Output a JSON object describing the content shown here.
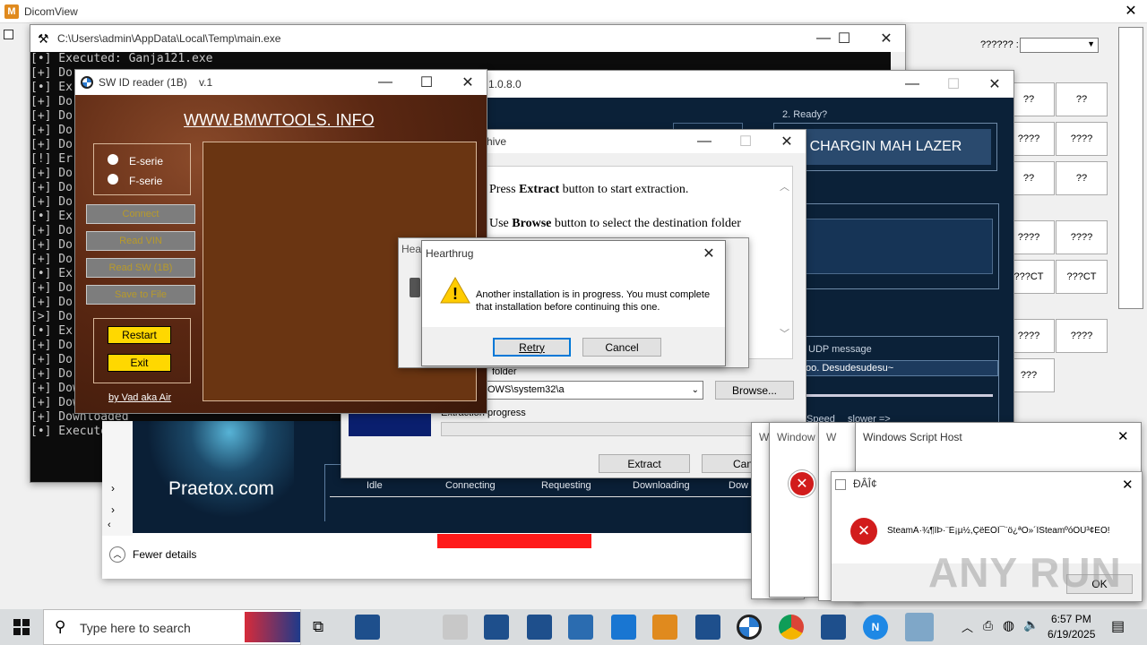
{
  "dicom": {
    "title": "DicomView",
    "field_label": "?????? :",
    "tiles": [
      "??",
      "??",
      "????",
      "????",
      "??",
      "??",
      "????",
      "????",
      "???CT",
      "???CT",
      "????",
      "????",
      "???"
    ]
  },
  "console": {
    "title": "C:\\Users\\admin\\AppData\\Local\\Temp\\main.exe",
    "lines": [
      "[•] Executed: Ganja121.exe",
      "[+] Do",
      "[•] Ex",
      "[+] Do",
      "[+] Do",
      "[+] Do",
      "[+] Do",
      "[!] Er",
      "[+] Do",
      "[+] Do",
      "[+] Do",
      "[•] Ex",
      "[+] Do",
      "[+] Do",
      "[+] Do",
      "[•] Ex",
      "[+] Do",
      "[+] Do",
      "[>] Do",
      "[•] Ex",
      "[+] Do",
      "[+] Do",
      "[+] Do",
      "[+] Downloaded",
      "[+] Downloaded",
      "[+] Downloaded",
      "[•] Executed: "
    ]
  },
  "swid": {
    "title": "SW ID reader (1B)    v.1",
    "site": "WWW.BMWTOOLS. INFO",
    "radio1": "E-serie",
    "radio2": "F-serie",
    "btn_connect": "Connect",
    "btn_readvin": "Read VIN",
    "btn_readsw": "Read SW (1B)",
    "btn_save": "Save to File",
    "btn_restart": "Restart",
    "btn_exit": "Exit",
    "credit": "by Vad aka Air"
  },
  "orion": {
    "version": "1.0.8.0",
    "step2": "2. Ready?",
    "banner": "MA CHARGIN MAH LAZER",
    "udp_label": "UDP message",
    "udp_value": "oo. Desudesudesu~",
    "speed": "Speed",
    "slower": "slower =>"
  },
  "progress_panel": {
    "tabs": [
      "Idle",
      "Connecting",
      "Requesting",
      "Downloading",
      "Dow"
    ],
    "brand": "Praetox.com",
    "fewer": "Fewer details"
  },
  "archive": {
    "title_suffix": "hive",
    "line1_pre": "Press ",
    "line1_bold": "Extract",
    "line1_post": " button to start extraction.",
    "line2_pre": "Use ",
    "line2_bold": "Browse",
    "line2_post": " button to select the destination folder",
    "folder_label": "folder",
    "folder_value": "OWS\\system32\\a",
    "browse": "Browse...",
    "progress_label": "Extraction progress",
    "extract": "Extract",
    "cancel": "Cance"
  },
  "hearth_bg": {
    "title": "Hear"
  },
  "hearthrug": {
    "title": "Hearthrug",
    "message": "Another installation is in progress. You must complete that installation before continuing this one.",
    "retry": "Retry",
    "cancel": "Cancel"
  },
  "wsh": {
    "small1": "W",
    "small2": "Window",
    "small3": "W",
    "title": "Windows Script Host"
  },
  "steam_err": {
    "title": "ÐÂÎ¢",
    "message": "SteamÂ·¾¶ÎÞ·¨È¡µ½,ÇëÈÖÎ¯¨ö¿ªÒ»´ÎSteamºóÔÙ³¢ÊÔ!",
    "ok": "OK"
  },
  "watermark": "ANY RUN",
  "taskbar": {
    "search_placeholder": "Type here to search",
    "time": "6:57 PM",
    "date": "6/19/2025"
  }
}
